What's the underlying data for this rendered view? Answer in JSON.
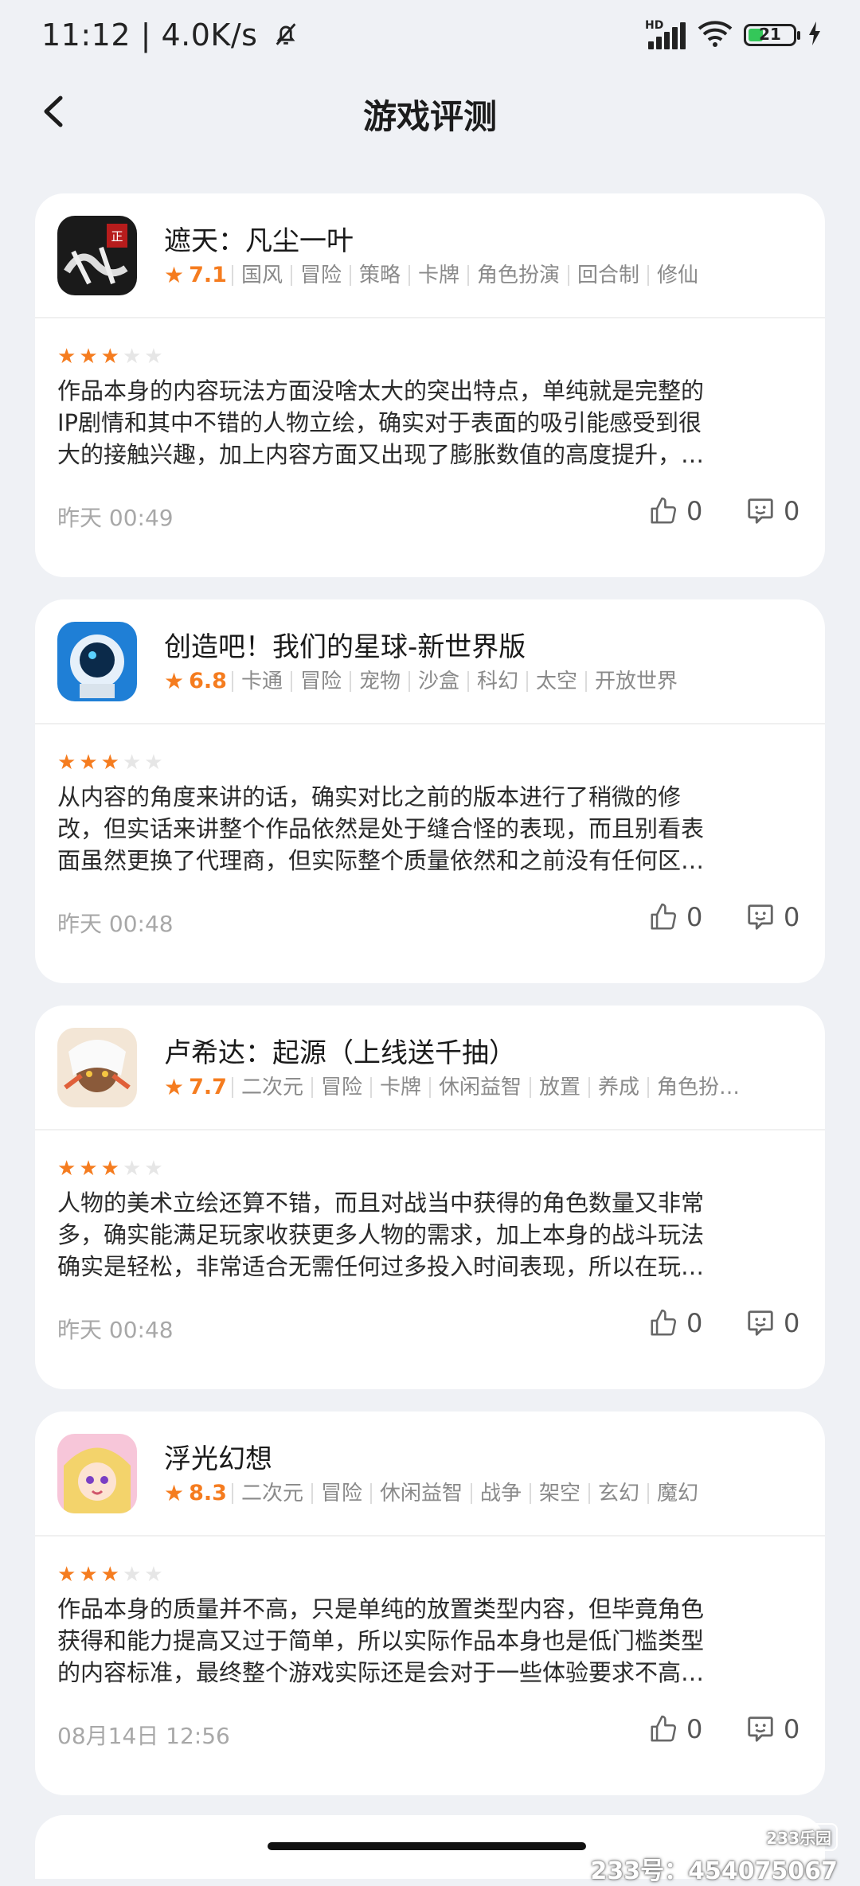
{
  "status": {
    "time": "11:12",
    "speed": "4.0K/s",
    "battery": "21",
    "hd": "HD"
  },
  "header": {
    "title": "游戏评测"
  },
  "cards": [
    {
      "name": "遮天：凡尘一叶",
      "score": "7.1",
      "tags": [
        "国风",
        "冒险",
        "策略",
        "卡牌",
        "角色扮演",
        "回合制",
        "修仙"
      ],
      "rating": 3,
      "lines": [
        "作品本身的内容玩法方面没啥太大的突出特点，单纯就是完整的",
        "IP剧情和其中不错的人物立绘，确实对于表面的吸引能感受到很",
        "大的接触兴趣，加上内容方面又出现了膨胀数值的高度提升，…"
      ],
      "time": "昨天 00:49",
      "likes": "0",
      "comments": "0"
    },
    {
      "name": "创造吧！我们的星球-新世界版",
      "score": "6.8",
      "tags": [
        "卡通",
        "冒险",
        "宠物",
        "沙盒",
        "科幻",
        "太空",
        "开放世界"
      ],
      "rating": 3,
      "lines": [
        "从内容的角度来讲的话，确实对比之前的版本进行了稍微的修",
        "改，但实话来讲整个作品依然是处于缝合怪的表现，而且别看表",
        "面虽然更换了代理商，但实际整个质量依然和之前没有任何区…"
      ],
      "time": "昨天 00:48",
      "likes": "0",
      "comments": "0"
    },
    {
      "name": "卢希达：起源（上线送千抽）",
      "score": "7.7",
      "tags": [
        "二次元",
        "冒险",
        "卡牌",
        "休闲益智",
        "放置",
        "养成",
        "角色扮…"
      ],
      "rating": 3,
      "lines": [
        "人物的美术立绘还算不错，而且对战当中获得的角色数量又非常",
        "多，确实能满足玩家收获更多人物的需求，加上本身的战斗玩法",
        "确实是轻松，非常适合无需任何过多投入时间表现，所以在玩…"
      ],
      "time": "昨天 00:48",
      "likes": "0",
      "comments": "0"
    },
    {
      "name": "浮光幻想",
      "score": "8.3",
      "tags": [
        "二次元",
        "冒险",
        "休闲益智",
        "战争",
        "架空",
        "玄幻",
        "魔幻"
      ],
      "rating": 3,
      "lines": [
        "作品本身的质量并不高，只是单纯的放置类型内容，但毕竟角色",
        "获得和能力提高又过于简单，所以实际作品本身也是低门槛类型",
        "的内容标准，最终整个游戏实际还是会对于一些体验要求不高…"
      ],
      "time": "08月14日 12:56",
      "likes": "0",
      "comments": "0"
    }
  ],
  "watermark": {
    "brand": "233乐园",
    "id": "233号：454075067"
  }
}
